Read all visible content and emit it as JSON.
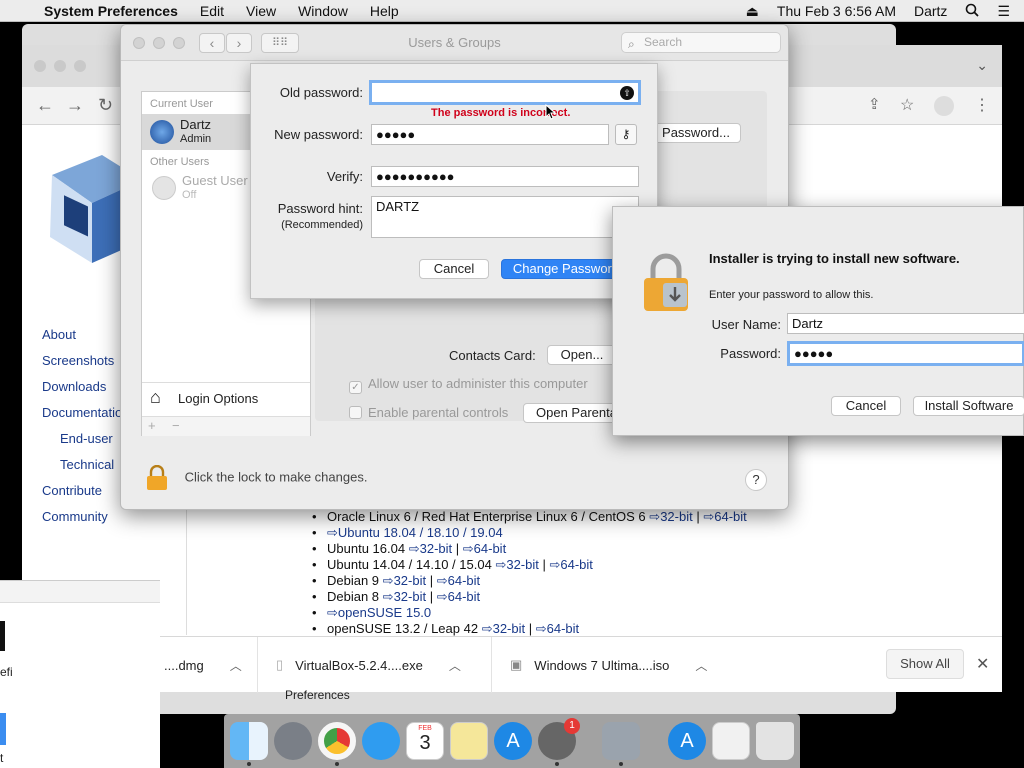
{
  "menubar": {
    "app_name": "System Preferences",
    "items": [
      "Edit",
      "View",
      "Window",
      "Help"
    ],
    "clock": "Thu Feb 3  6:56 AM",
    "user": "Dartz"
  },
  "browser": {
    "sidebar_links": [
      "About",
      "Screenshots",
      "Downloads",
      "Documentation",
      "End-user",
      "Technical",
      "Contribute",
      "Community"
    ],
    "downloads": [
      {
        "name": "Oracle Linux 6 / Red Hat Enterprise Linux 6 / CentOS 6",
        "links": [
          "32-bit",
          "64-bit"
        ]
      },
      {
        "name": "",
        "links": [
          "Ubuntu 18.04 / 18.10 / 19.04"
        ]
      },
      {
        "name": "Ubuntu 16.04",
        "links": [
          "32-bit",
          "64-bit"
        ]
      },
      {
        "name": "Ubuntu 14.04 / 14.10 / 15.04",
        "links": [
          "32-bit",
          "64-bit"
        ]
      },
      {
        "name": "Debian 9",
        "links": [
          "32-bit",
          "64-bit"
        ]
      },
      {
        "name": "Debian 8",
        "links": [
          "32-bit",
          "64-bit"
        ]
      },
      {
        "name": "",
        "links": [
          "openSUSE 15.0"
        ]
      },
      {
        "name": "openSUSE 13.2 / Leap 42",
        "links": [
          "32-bit",
          "64-bit"
        ]
      }
    ],
    "download_bar": {
      "items": [
        "....dmg",
        "VirtualBox-5.2.4....exe",
        "Windows 7 Ultima....iso"
      ],
      "show_all": "Show All"
    },
    "behind_label": "Preferences"
  },
  "left_window": {
    "text": "efi",
    "text2": "t"
  },
  "system_prefs": {
    "title": "Users & Groups",
    "search_placeholder": "Search",
    "current_user_header": "Current User",
    "current_user_name": "Dartz",
    "current_user_role": "Admin",
    "other_users_header": "Other Users",
    "guest_name": "Guest User",
    "guest_status": "Off",
    "login_options": "Login Options",
    "password_button": "Password...",
    "contacts_label": "Contacts Card:",
    "open_button": "Open...",
    "allow_admin": "Allow user to administer this computer",
    "parental": "Enable parental controls",
    "open_parental": "Open Parental Controls...",
    "lock_text": "Click the lock to make changes.",
    "help": "?"
  },
  "password_sheet": {
    "old_label": "Old password:",
    "old_value": "",
    "error": "The password is incorrect.",
    "new_label": "New password:",
    "new_value": "●●●●●",
    "verify_label": "Verify:",
    "verify_value": "●●●●●●●●●●",
    "hint_label": "Password hint:",
    "hint_sub": "(Recommended)",
    "hint_value": "DARTZ",
    "cancel": "Cancel",
    "change": "Change Password"
  },
  "installer": {
    "title": "Installer is trying to install new software.",
    "message": "Enter your password to allow this.",
    "user_label": "User Name:",
    "user_value": "Dartz",
    "password_label": "Password:",
    "password_value": "●●●●●",
    "cancel": "Cancel",
    "install": "Install Software"
  },
  "dock": {
    "calendar_month": "FEB",
    "calendar_day": "3",
    "badge": "1"
  },
  "colors": {
    "accent": "#2f84f5",
    "error": "#d0021b",
    "link": "#1a3a8a"
  }
}
